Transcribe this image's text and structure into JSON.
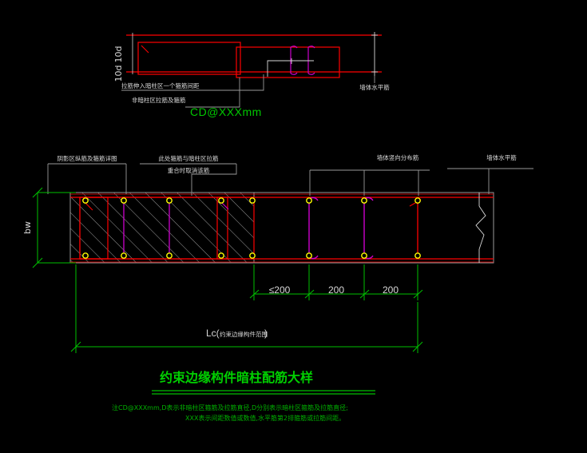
{
  "drawing": {
    "background": "#000000",
    "title": "约束边缘构件暗柱配筋大样",
    "title_color": "#00d000",
    "colors": {
      "rebar_red": "#ff0000",
      "tie_magenta": "#cc00cc",
      "dim_green": "#00c000",
      "annotation_white": "#d8d8d8",
      "hatch_gray": "#9a9a9a",
      "bar_dot": "#ffff00",
      "note_green": "#00b000"
    }
  },
  "top_detail": {
    "dim_left_upper": "10d",
    "dim_left_lower": "10d",
    "label_anchor": "拉筋伸入暗柱区一个箍筋间距",
    "label_stirrup": "非暗柱区拉筋及箍筋",
    "spec": "CD@XXXmm",
    "label_right": "墙体水平筋"
  },
  "section": {
    "label_confined": "阴影区纵筋及箍筋详图",
    "label_overlap_top": "此处箍筋与暗柱区拉筋",
    "label_overlap_bottom": "重合时取消该筋",
    "label_vertical_bars": "墙体竖向分布筋",
    "label_horizontal_bars": "墙体水平筋",
    "thickness_label": "bw",
    "spacings": [
      "≤200",
      "200",
      "200"
    ],
    "overall_dim": "Lc(",
    "overall_dim_cn": "约束边缘构件范围",
    "overall_dim_end": ")"
  },
  "notes": {
    "line1_prefix": "注CD@XXXmm,",
    "line1": "注CD@XXXmm,D表示非暗柱区箍筋及拉筋直径,D分别表示暗柱区箍筋及拉筋直径;",
    "line2": "XXX表示间距数值或数值,水平筋第2排箍筋或拉筋间距。"
  }
}
